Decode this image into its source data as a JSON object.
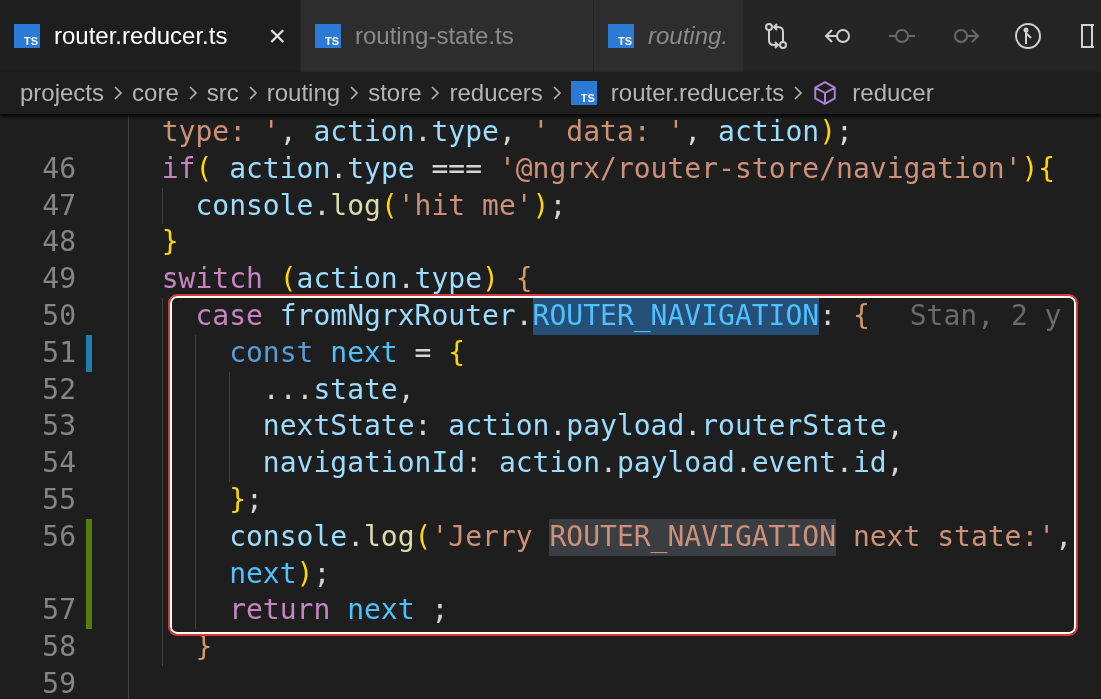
{
  "tabs": [
    {
      "icon_label": "TS",
      "label": "router.reducer.ts",
      "selected": true,
      "preview": false,
      "close": "×"
    },
    {
      "icon_label": "TS",
      "label": "routing-state.ts",
      "selected": false,
      "preview": false
    },
    {
      "icon_label": "TS",
      "label": "routing.",
      "selected": false,
      "preview": true
    }
  ],
  "toolbar": [
    {
      "kind": "compare",
      "disabled": false
    },
    {
      "kind": "back",
      "disabled": false
    },
    {
      "kind": "commit",
      "disabled": true
    },
    {
      "kind": "forward",
      "disabled": true
    },
    {
      "kind": "graph",
      "disabled": false
    },
    {
      "kind": "split",
      "disabled": false
    }
  ],
  "breadcrumbs": [
    {
      "kind": "folder",
      "label": "projects"
    },
    {
      "kind": "folder",
      "label": "core"
    },
    {
      "kind": "folder",
      "label": "src"
    },
    {
      "kind": "folder",
      "label": "routing"
    },
    {
      "kind": "folder",
      "label": "store"
    },
    {
      "kind": "folder",
      "label": "reducers"
    },
    {
      "kind": "file",
      "label": "router.reducer.ts",
      "icon_label": "TS"
    },
    {
      "kind": "symbol",
      "label": "reducer"
    }
  ],
  "lines": [
    {
      "tokens": [
        {
          "kind": "string",
          "text": "  type: '"
        },
        {
          "kind": "punct",
          "text": ", "
        },
        {
          "kind": "variable",
          "text": "action"
        },
        {
          "kind": "punct",
          "text": "."
        },
        {
          "kind": "variable",
          "text": "type"
        },
        {
          "kind": "punct",
          "text": ", "
        },
        {
          "kind": "string",
          "text": "' data: '"
        },
        {
          "kind": "punct",
          "text": ", "
        },
        {
          "kind": "variable",
          "text": "action"
        },
        {
          "kind": "bracket1",
          "text": ")"
        },
        {
          "kind": "punct",
          "text": ";"
        }
      ]
    },
    {
      "number": "46",
      "tokens": [
        {
          "kind": "keyword",
          "text": "  if"
        },
        {
          "kind": "bracket1",
          "text": "("
        },
        {
          "kind": "variable",
          "text": " action"
        },
        {
          "kind": "punct",
          "text": "."
        },
        {
          "kind": "variable",
          "text": "type"
        },
        {
          "kind": "punct",
          "text": " === "
        },
        {
          "kind": "string",
          "text": "'@ngrx/router-store/navigation'"
        },
        {
          "kind": "bracket1",
          "text": ")"
        },
        {
          "kind": "bracket1",
          "text": "{"
        }
      ]
    },
    {
      "number": "47",
      "tokens": [
        {
          "kind": "variable",
          "text": "    console"
        },
        {
          "kind": "punct",
          "text": "."
        },
        {
          "kind": "function",
          "text": "log"
        },
        {
          "kind": "bracket1",
          "text": "("
        },
        {
          "kind": "string",
          "text": "'hit me'"
        },
        {
          "kind": "bracket1",
          "text": ")"
        },
        {
          "kind": "punct",
          "text": ";"
        }
      ]
    },
    {
      "number": "48",
      "tokens": [
        {
          "kind": "bracket1",
          "text": "  }"
        }
      ]
    },
    {
      "number": "49",
      "tokens": [
        {
          "kind": "keyword",
          "text": "  switch "
        },
        {
          "kind": "bracket1",
          "text": "("
        },
        {
          "kind": "variable",
          "text": "action"
        },
        {
          "kind": "punct",
          "text": "."
        },
        {
          "kind": "variable",
          "text": "type"
        },
        {
          "kind": "bracket1",
          "text": ")"
        },
        {
          "kind": "bracket2",
          "text": " {"
        }
      ]
    },
    {
      "number": "50",
      "blame": "Stan, 2 y",
      "tokens": [
        {
          "kind": "keyword",
          "text": "    case "
        },
        {
          "kind": "variable",
          "text": "fromNgrxRouter"
        },
        {
          "kind": "punct",
          "text": "."
        },
        {
          "kind": "constant",
          "text": "ROUTER_NAVIGATION",
          "selection": true
        },
        {
          "kind": "punct",
          "text": ":"
        },
        {
          "kind": "bracket2",
          "text": " {"
        }
      ]
    },
    {
      "number": "51",
      "modified": true,
      "tokens": [
        {
          "kind": "storage",
          "text": "      const "
        },
        {
          "kind": "constant",
          "text": "next"
        },
        {
          "kind": "punct",
          "text": " = "
        },
        {
          "kind": "bracket1",
          "text": "{"
        }
      ]
    },
    {
      "number": "52",
      "tokens": [
        {
          "kind": "punct",
          "text": "        ..."
        },
        {
          "kind": "variable",
          "text": "state"
        },
        {
          "kind": "punct",
          "text": ","
        }
      ]
    },
    {
      "number": "53",
      "tokens": [
        {
          "kind": "variable",
          "text": "        nextState"
        },
        {
          "kind": "punct",
          "text": ": "
        },
        {
          "kind": "variable",
          "text": "action"
        },
        {
          "kind": "punct",
          "text": "."
        },
        {
          "kind": "variable",
          "text": "payload"
        },
        {
          "kind": "punct",
          "text": "."
        },
        {
          "kind": "variable",
          "text": "routerState"
        },
        {
          "kind": "punct",
          "text": ","
        }
      ]
    },
    {
      "number": "54",
      "tokens": [
        {
          "kind": "variable",
          "text": "        navigationId"
        },
        {
          "kind": "punct",
          "text": ": "
        },
        {
          "kind": "variable",
          "text": "action"
        },
        {
          "kind": "punct",
          "text": "."
        },
        {
          "kind": "variable",
          "text": "payload"
        },
        {
          "kind": "punct",
          "text": "."
        },
        {
          "kind": "variable",
          "text": "event"
        },
        {
          "kind": "punct",
          "text": "."
        },
        {
          "kind": "variable",
          "text": "id"
        },
        {
          "kind": "punct",
          "text": ","
        }
      ]
    },
    {
      "number": "55",
      "tokens": [
        {
          "kind": "bracket1",
          "text": "      }"
        },
        {
          "kind": "punct",
          "text": ";"
        }
      ]
    },
    {
      "number": "56",
      "added": true,
      "tokens": [
        {
          "kind": "variable",
          "text": "      console"
        },
        {
          "kind": "punct",
          "text": "."
        },
        {
          "kind": "function",
          "text": "log"
        },
        {
          "kind": "bracket1",
          "text": "("
        },
        {
          "kind": "string",
          "text": "'Jerry "
        },
        {
          "kind": "string",
          "text": "ROUTER_NAVIGATION",
          "match": true
        },
        {
          "kind": "string",
          "text": " next state:'"
        },
        {
          "kind": "punct",
          "text": ","
        }
      ]
    },
    {
      "added": true,
      "tokens": [
        {
          "kind": "constant",
          "text": "      next"
        },
        {
          "kind": "bracket1",
          "text": ")"
        },
        {
          "kind": "punct",
          "text": ";"
        }
      ]
    },
    {
      "number": "57",
      "added": true,
      "tokens": [
        {
          "kind": "keyword",
          "text": "      return "
        },
        {
          "kind": "constant",
          "text": "next"
        },
        {
          "kind": "punct",
          "text": " ;"
        }
      ]
    },
    {
      "number": "58",
      "tokens": [
        {
          "kind": "bracket2",
          "text": "    }"
        }
      ]
    },
    {
      "number": "59"
    }
  ]
}
